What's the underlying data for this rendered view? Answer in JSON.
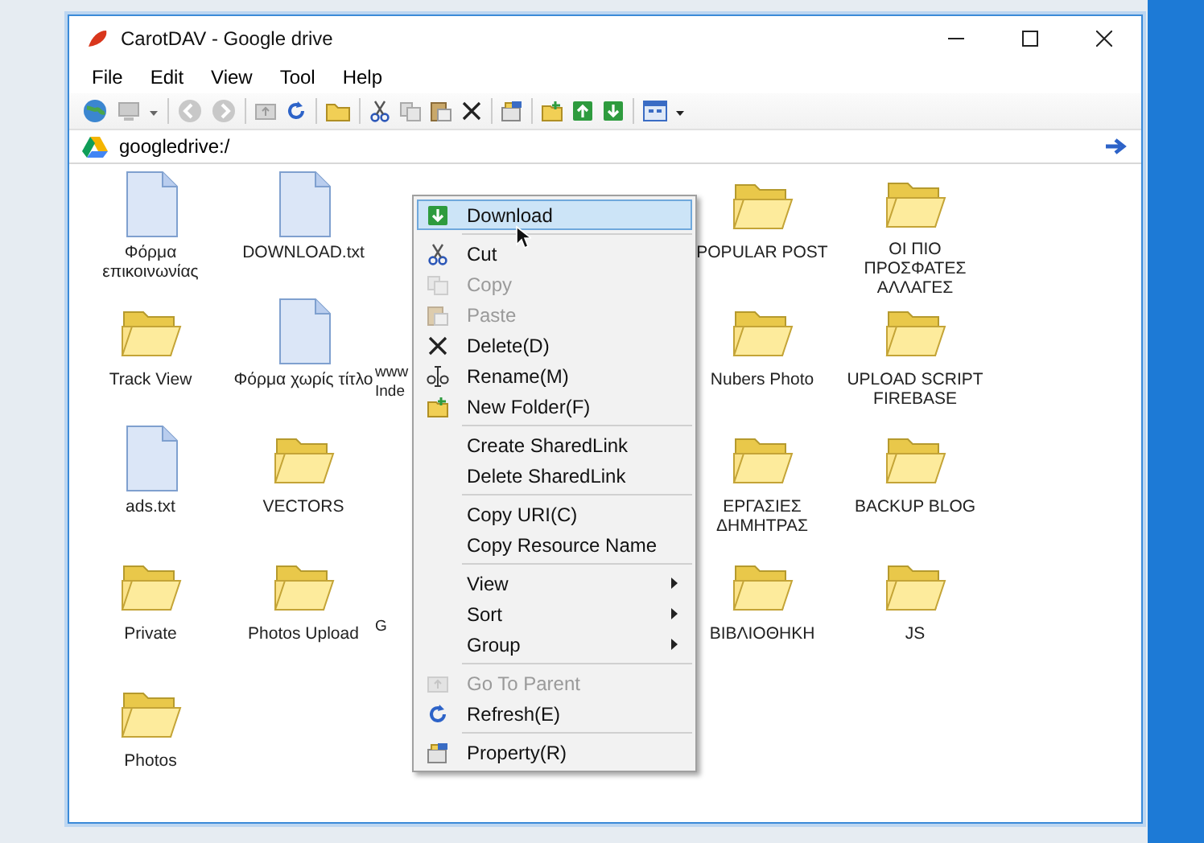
{
  "window": {
    "title": "CarotDAV - Google drive"
  },
  "menu_bar": [
    "File",
    "Edit",
    "View",
    "Tool",
    "Help"
  ],
  "address_bar": {
    "value": "googledrive:/"
  },
  "files": [
    {
      "kind": "file",
      "label": "Φόρμα επικοινωνίας"
    },
    {
      "kind": "file",
      "label": "DOWNLOAD.txt"
    },
    {
      "kind": "blank"
    },
    {
      "kind": "blank"
    },
    {
      "kind": "folder",
      "label": "POPULAR POST"
    },
    {
      "kind": "folder",
      "label": "ΟΙ ΠΙΟ ΠΡΟΣΦΑΤΕΣ ΑΛΛΑΓΕΣ"
    },
    {
      "kind": "folder",
      "label": "Track View"
    },
    {
      "kind": "file",
      "label": "Φόρμα χωρίς τίτλο"
    },
    {
      "kind": "partial",
      "label": "www Inde"
    },
    {
      "kind": "blank"
    },
    {
      "kind": "folder",
      "label": "Nubers Photo"
    },
    {
      "kind": "folder",
      "label": "UPLOAD SCRIPT FIREBASE"
    },
    {
      "kind": "file",
      "label": "ads.txt"
    },
    {
      "kind": "folder",
      "label": "VECTORS"
    },
    {
      "kind": "blank"
    },
    {
      "kind": "blank"
    },
    {
      "kind": "folder",
      "label": "ΕΡΓΑΣΙΕΣ ΔΗΜΗΤΡΑΣ"
    },
    {
      "kind": "folder",
      "label": "BACKUP BLOG"
    },
    {
      "kind": "folder",
      "label": "Private"
    },
    {
      "kind": "folder",
      "label": "Photos Upload"
    },
    {
      "kind": "partial",
      "label": "G"
    },
    {
      "kind": "blank"
    },
    {
      "kind": "folder",
      "label": "ΒΙΒΛΙΟΘΗΚΗ"
    },
    {
      "kind": "folder",
      "label": "JS"
    },
    {
      "kind": "folder",
      "label": "Photos"
    }
  ],
  "context_menu": {
    "groups": [
      [
        {
          "label": "Download",
          "selected": true,
          "disabled": false,
          "submenu": false
        }
      ],
      [
        {
          "label": "Cut",
          "selected": false,
          "disabled": false,
          "submenu": false
        },
        {
          "label": "Copy",
          "selected": false,
          "disabled": true,
          "submenu": false
        },
        {
          "label": "Paste",
          "selected": false,
          "disabled": true,
          "submenu": false
        },
        {
          "label": "Delete(D)",
          "selected": false,
          "disabled": false,
          "submenu": false
        },
        {
          "label": "Rename(M)",
          "selected": false,
          "disabled": false,
          "submenu": false
        },
        {
          "label": "New Folder(F)",
          "selected": false,
          "disabled": false,
          "submenu": false
        }
      ],
      [
        {
          "label": "Create SharedLink",
          "selected": false,
          "disabled": false,
          "submenu": false
        },
        {
          "label": "Delete SharedLink",
          "selected": false,
          "disabled": false,
          "submenu": false
        }
      ],
      [
        {
          "label": "Copy URI(C)",
          "selected": false,
          "disabled": false,
          "submenu": false
        },
        {
          "label": "Copy Resource Name",
          "selected": false,
          "disabled": false,
          "submenu": false
        }
      ],
      [
        {
          "label": "View",
          "selected": false,
          "disabled": false,
          "submenu": true
        },
        {
          "label": "Sort",
          "selected": false,
          "disabled": false,
          "submenu": true
        },
        {
          "label": "Group",
          "selected": false,
          "disabled": false,
          "submenu": true
        }
      ],
      [
        {
          "label": "Go To Parent",
          "selected": false,
          "disabled": true,
          "submenu": false
        },
        {
          "label": "Refresh(E)",
          "selected": false,
          "disabled": false,
          "submenu": false
        }
      ],
      [
        {
          "label": "Property(R)",
          "selected": false,
          "disabled": false,
          "submenu": false
        }
      ]
    ]
  }
}
